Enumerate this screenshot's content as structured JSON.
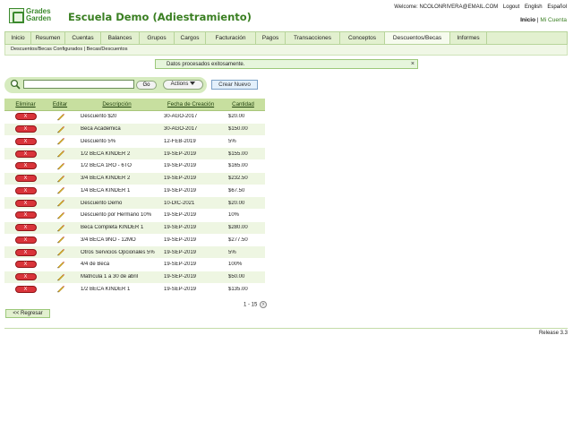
{
  "logo": {
    "line1": "Grades",
    "line2": "Garden"
  },
  "app_title": "Escuela Demo (Adiestramiento)",
  "top_links": {
    "welcome": "Welcome: NCOLONRIVERA@EMAIL.COM",
    "logout": "Logout",
    "english": "English",
    "espanol": "Español"
  },
  "account_links": {
    "inicio": "Inicio",
    "separator": "|",
    "mi_cuenta": "Mi Cuenta"
  },
  "nav": {
    "items": [
      "Inicio",
      "Resumen",
      "Cuentas",
      "Balances",
      "Grupos",
      "Cargos",
      "Facturación",
      "Pagos",
      "Transacciones",
      "Conceptos",
      "Descuentos/Becas",
      "Informes"
    ],
    "active": "Descuentos/Becas"
  },
  "breadcrumb": {
    "part1": "Descuentos/Becas Configurados",
    "separator": "|",
    "part2": "Becas/Descuentos"
  },
  "message": {
    "text": "Datos procesados exitosamente.",
    "close": "×"
  },
  "search": {
    "value": "",
    "go_label": "Go",
    "actions_label": "Actions"
  },
  "create_label": "Crear Nuevo",
  "table": {
    "headers": [
      "Eliminar",
      "Editar",
      "Descripción",
      "Fecha de Creación",
      "Cantidad"
    ],
    "delete_label": "X",
    "rows": [
      [
        "Descuento $20",
        "30-AGO-2017",
        "$20.00"
      ],
      [
        "Beca Academica",
        "30-AGO-2017",
        "$150.00"
      ],
      [
        "Descuento 5%",
        "12-FEB-2019",
        "5%"
      ],
      [
        "1/2 BECA KINDER 2",
        "19-SEP-2019",
        "$155.00"
      ],
      [
        "1/2 BECA 1RO - 6TO",
        "19-SEP-2019",
        "$165.00"
      ],
      [
        "3/4 BECA KINDER 2",
        "19-SEP-2019",
        "$232.50"
      ],
      [
        "1/4 BECA KINDER 1",
        "19-SEP-2019",
        "$67.50"
      ],
      [
        "Descuento Demo",
        "10-DIC-2021",
        "$20.00"
      ],
      [
        "Descuento por Hermano 10%",
        "19-SEP-2019",
        "10%"
      ],
      [
        "Beca Completa KINDER 1",
        "19-SEP-2019",
        "$280.00"
      ],
      [
        "3/4 BECA 9NO - 12MO",
        "19-SEP-2019",
        "$277.50"
      ],
      [
        "Otros Servicios Opcionales 5%",
        "19-SEP-2019",
        "5%"
      ],
      [
        "4/4 de Beca",
        "19-SEP-2019",
        "100%"
      ],
      [
        "Matricula 1 a 30 de abril",
        "19-SEP-2019",
        "$50.00"
      ],
      [
        "1/2 BECA KINDER 1",
        "19-SEP-2019",
        "$135.00"
      ]
    ]
  },
  "pager": {
    "text": "1 - 15",
    "next": "›"
  },
  "back_label": "<< Regresar",
  "release": "Release 3.3",
  "colors": {
    "accent": "#3a7f22",
    "nav_bg": "#e2f0cf",
    "header_row": "#c7df9f",
    "delete_red": "#d9343a"
  }
}
